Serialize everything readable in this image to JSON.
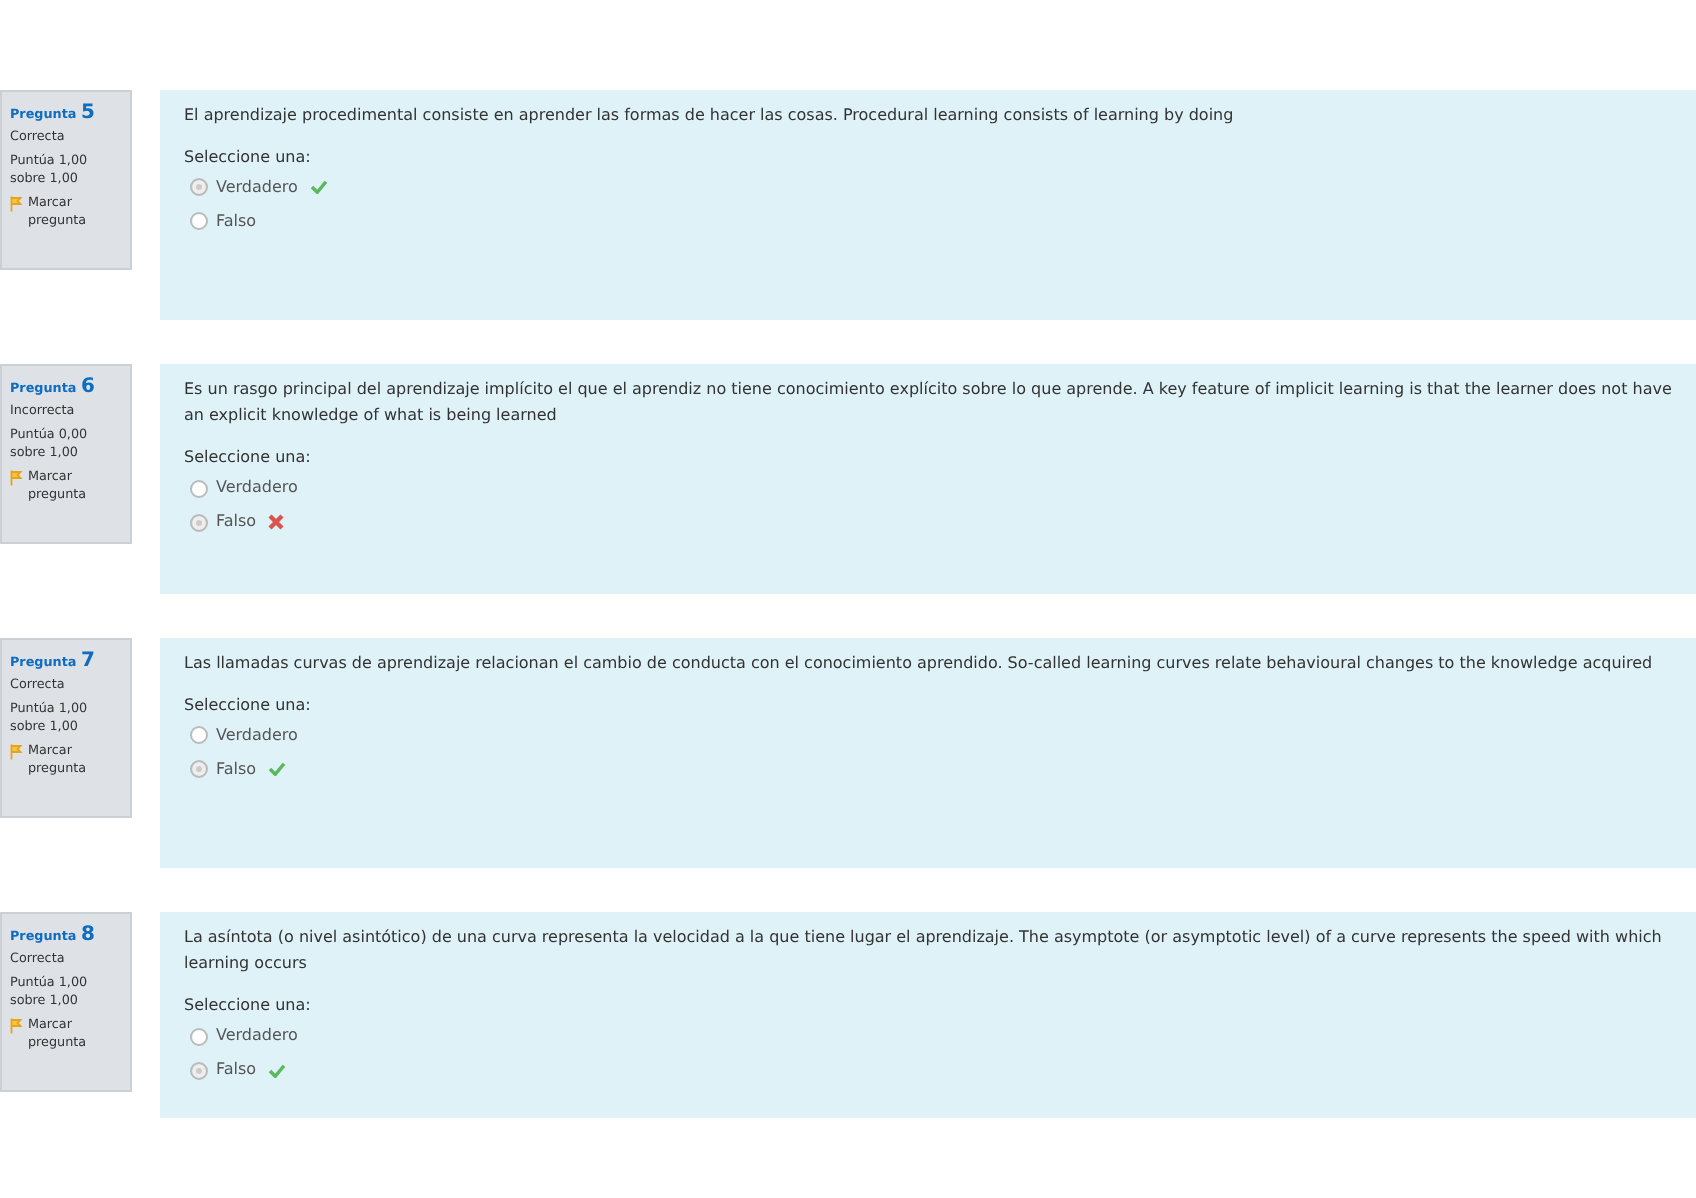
{
  "questions": [
    {
      "label": "Pregunta",
      "number": "5",
      "status": "Correcta",
      "score": "Puntúa 1,00 sobre 1,00",
      "flag": "Marcar pregunta",
      "text": "El aprendizaje procedimental consiste en aprender las formas de hacer las cosas. Procedural learning consists of learning by doing",
      "prompt": "Seleccione una:",
      "options": [
        {
          "label": "Verdadero",
          "selected": true,
          "correct": true
        },
        {
          "label": "Falso",
          "selected": false
        }
      ]
    },
    {
      "label": "Pregunta",
      "number": "6",
      "status": "Incorrecta",
      "score": "Puntúa 0,00 sobre 1,00",
      "flag": "Marcar pregunta",
      "text": "Es un rasgo principal del aprendizaje implícito el que el aprendiz no tiene conocimiento explícito sobre lo que aprende. A key feature of implicit learning is that the learner does not have an explicit knowledge of what is being learned",
      "prompt": "Seleccione una:",
      "options": [
        {
          "label": "Verdadero",
          "selected": false
        },
        {
          "label": "Falso",
          "selected": true,
          "correct": false
        }
      ]
    },
    {
      "label": "Pregunta",
      "number": "7",
      "status": "Correcta",
      "score": "Puntúa 1,00 sobre 1,00",
      "flag": "Marcar pregunta",
      "text": "Las llamadas curvas de aprendizaje relacionan el cambio de conducta con el conocimiento aprendido. So-called learning curves relate behavioural changes to the knowledge acquired",
      "prompt": "Seleccione una:",
      "options": [
        {
          "label": "Verdadero",
          "selected": false
        },
        {
          "label": "Falso",
          "selected": true,
          "correct": true
        }
      ]
    },
    {
      "label": "Pregunta",
      "number": "8",
      "status": "Correcta",
      "score": "Puntúa 1,00 sobre 1,00",
      "flag": "Marcar pregunta",
      "text": "La asíntota (o nivel asintótico) de una curva representa la velocidad a la que tiene lugar el aprendizaje. The asymptote (or asymptotic level) of a curve represents the speed with which learning occurs",
      "prompt": "Seleccione una:",
      "options": [
        {
          "label": "Verdadero",
          "selected": false
        },
        {
          "label": "Falso",
          "selected": true,
          "correct": true
        }
      ]
    }
  ]
}
